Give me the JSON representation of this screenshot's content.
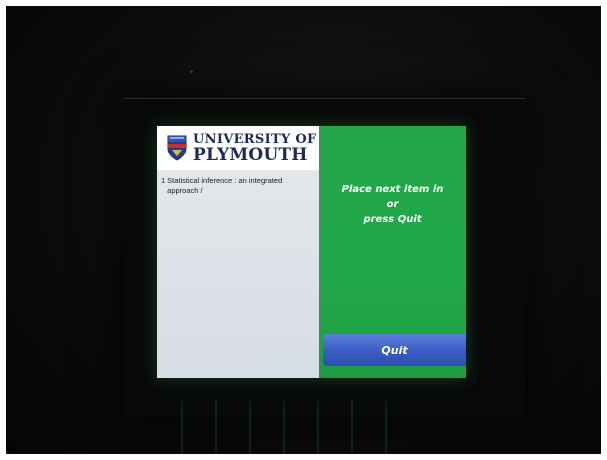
{
  "header": {
    "logo_line1": "UNIVERSITY OF",
    "logo_line2": "PLYMOUTH"
  },
  "items": [
    {
      "index": "1",
      "title_line1": "Statistical inference : an integrated",
      "title_line2": "approach /"
    }
  ],
  "instruction": {
    "line1": "Place next item in",
    "line2": "or",
    "line3": "press Quit"
  },
  "buttons": {
    "quit_label": "Quit"
  },
  "colors": {
    "panel_green": "#21a84a",
    "quit_blue": "#3a5cc2",
    "logo_navy": "#1c2b5a"
  }
}
